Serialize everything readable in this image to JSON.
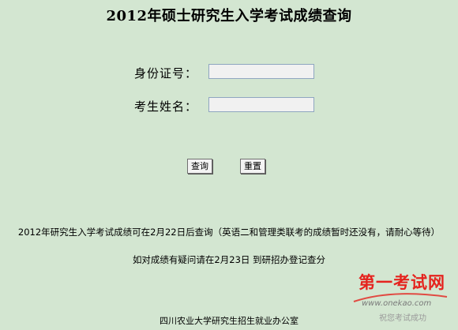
{
  "page": {
    "title": "2012年硕士研究生入学考试成绩查询"
  },
  "form": {
    "id_label": "身份证号：",
    "id_value": "",
    "name_label": "考生姓名：",
    "name_value": "",
    "query_button": "查询",
    "reset_button": "重置"
  },
  "notices": {
    "line1": "2012年研究生入学考试成绩可在2月22日后查询（英语二和管理类联考的成绩暂时还没有，请耐心等待）",
    "line2": "如对成绩有疑问请在2月23日 到研招办登记查分"
  },
  "footer": {
    "text": "四川农业大学研究生招生就业办公室"
  },
  "watermark": {
    "brand": "第一考试网",
    "url": "www.onekao.com",
    "slogan": "祝您考试成功"
  },
  "colors": {
    "background": "#d3e6d1",
    "input_background": "#f1f1f1",
    "input_border": "#8fa6c0",
    "watermark_red": "#e5231e"
  }
}
